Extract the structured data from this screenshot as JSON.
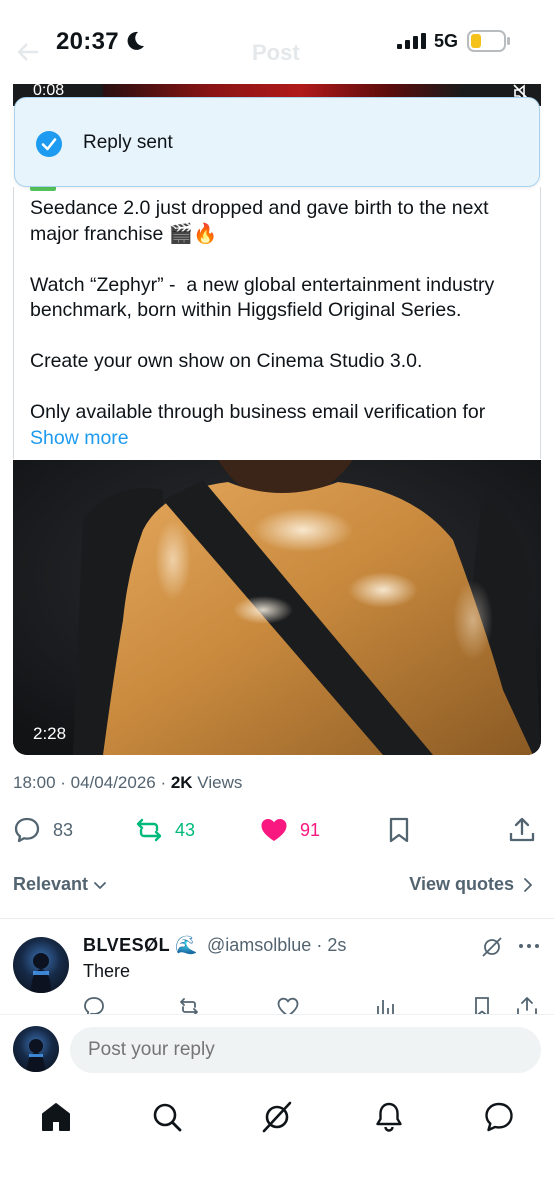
{
  "status_bar": {
    "time": "20:37",
    "network": "5G",
    "faded_header_title": "Post"
  },
  "top_video": {
    "timecode": "0:08"
  },
  "toast": {
    "message": "Reply sent"
  },
  "tweet": {
    "text": "Seedance 2.0 just dropped and gave birth to the next major franchise 🎬🔥\n\nWatch “Zephyr” -  a new global entertainment industry benchmark, born within Higgsfield Original Series.\n\nCreate your own show on Cinema Studio 3.0.\n\nOnly available through business email verification for ",
    "show_more": "Show more",
    "media_duration": "2:28",
    "timestamp": "18:00 · 04/04/2026 · ",
    "views_count": "2K",
    "views_label": " Views"
  },
  "actions": {
    "replies": "83",
    "reposts": "43",
    "likes": "91"
  },
  "sort": {
    "label": "Relevant",
    "view_quotes": "View quotes"
  },
  "reply": {
    "name": "BLVESØL 🌊",
    "handle": "@iamsolblue · 2s",
    "text": "There"
  },
  "composer": {
    "placeholder": "Post your reply"
  },
  "colors": {
    "accent": "#1d9bf0",
    "repost_green": "#00ba7c",
    "like_pink": "#f91880",
    "secondary_text": "#536471"
  }
}
